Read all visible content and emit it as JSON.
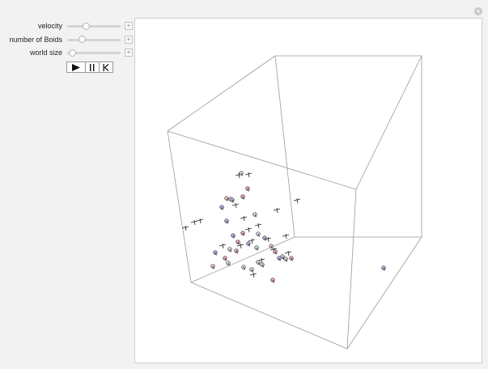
{
  "controls": {
    "sliders": [
      {
        "id": "velocity",
        "label": "velocity",
        "value": 0.35
      },
      {
        "id": "number-of-boids",
        "label": "number of Boids",
        "value": 0.28
      },
      {
        "id": "world-size",
        "label": "world size",
        "value": 0.1
      }
    ],
    "plus_glyph": "+"
  },
  "animation": {
    "play_icon": "play-icon",
    "pause_icon": "pause-icon",
    "reset_icon": "step-back-icon"
  },
  "corner_plus_glyph": "+",
  "colors": {
    "box_edge": "#9a9a9a",
    "boid_outline": "#333333",
    "boid_fills": [
      "#e9a6b1",
      "#b7b0e6",
      "#d8d8e8",
      "#f4c6c6"
    ]
  }
}
